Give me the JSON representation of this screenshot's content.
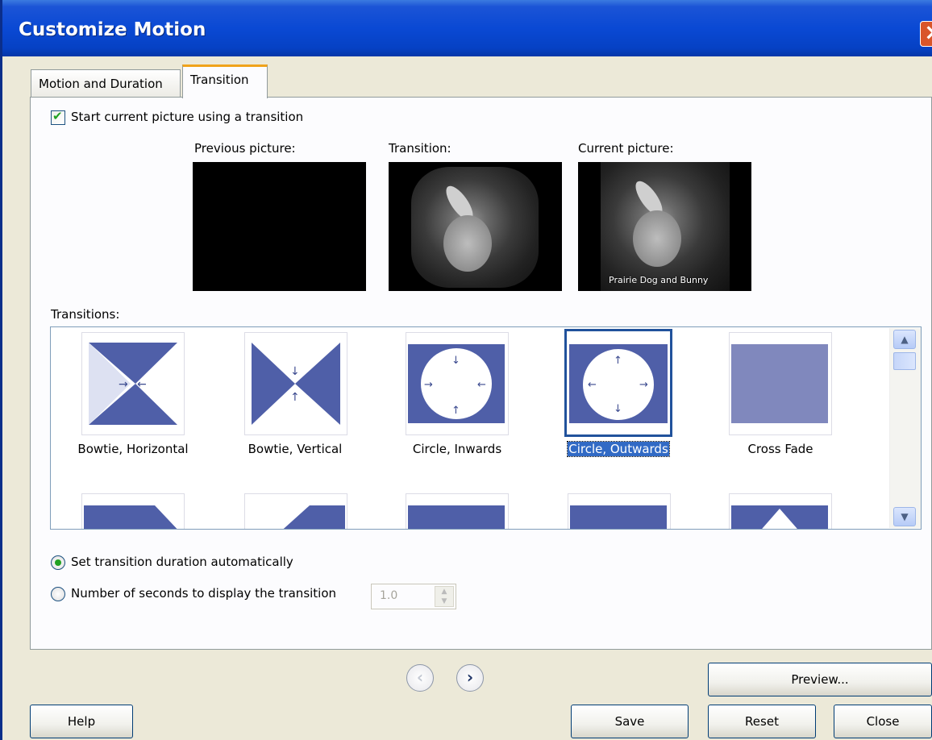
{
  "window": {
    "title": "Customize Motion"
  },
  "tabs": [
    {
      "label": "Motion and Duration",
      "active": false
    },
    {
      "label": "Transition",
      "active": true
    }
  ],
  "start_checkbox": {
    "label": "Start current picture using a transition",
    "checked": true
  },
  "previews": {
    "previous_label": "Previous picture:",
    "transition_label": "Transition:",
    "current_label": "Current picture:",
    "caption": "Prairie Dog and Bunny"
  },
  "transitions_label": "Transitions:",
  "transitions": [
    {
      "label": "Bowtie, Horizontal",
      "icon": "bowtie-horizontal-icon",
      "selected": false
    },
    {
      "label": "Bowtie, Vertical",
      "icon": "bowtie-vertical-icon",
      "selected": false
    },
    {
      "label": "Circle, Inwards",
      "icon": "circle-inwards-icon",
      "selected": false
    },
    {
      "label": "Circle, Outwards",
      "icon": "circle-outwards-icon",
      "selected": true
    },
    {
      "label": "Cross Fade",
      "icon": "cross-fade-icon",
      "selected": false
    }
  ],
  "duration": {
    "auto_label": "Set transition duration automatically",
    "auto_selected": true,
    "manual_label": "Number of seconds to display the transition",
    "seconds_value": "1.0"
  },
  "buttons": {
    "preview": "Preview...",
    "help": "Help",
    "save": "Save",
    "reset": "Reset",
    "close": "Close"
  },
  "colors": {
    "titlebar": "#0a49d4",
    "icon_blue": "#4f5fa8",
    "selection": "#316ac5",
    "check_green": "#21a121"
  }
}
